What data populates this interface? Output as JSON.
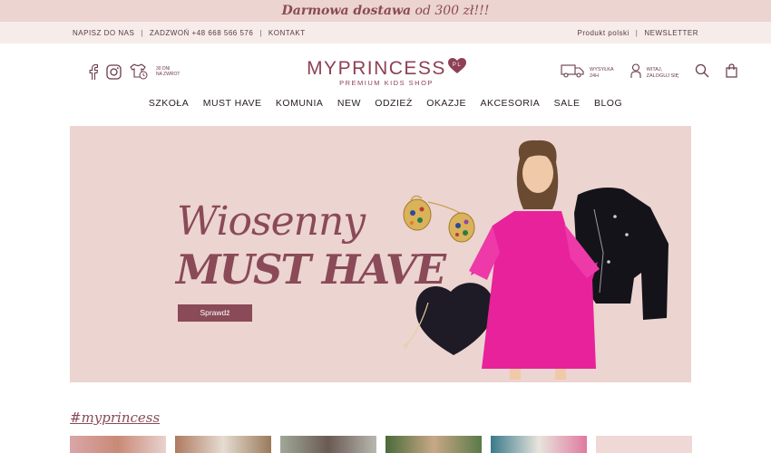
{
  "promo": {
    "bold": "Darmowa dostawa",
    "rest": " od 300 zł!!!"
  },
  "top_links": {
    "left": [
      "NAPISZ DO NAS",
      "ZADZWOŃ +48 668 566 576",
      "KONTAKT"
    ],
    "right": [
      "Produkt polski",
      "NEWSLETTER"
    ]
  },
  "header": {
    "returns_line1": "30 DNI",
    "returns_line2": "NA ZWROT",
    "logo": "MYPRINCESS",
    "logo_badge": "PL",
    "tagline": "PREMIUM KIDS SHOP",
    "shipping_line1": "WYSYŁKA",
    "shipping_line2": "24H",
    "account_line1": "WITAJ,",
    "account_line2": "ZALOGUJ SIĘ"
  },
  "nav": [
    "SZKOŁA",
    "MUST HAVE",
    "KOMUNIA",
    "NEW",
    "ODZIEŻ",
    "OKAZJE",
    "AKCESORIA",
    "SALE",
    "BLOG"
  ],
  "hero": {
    "line1": "Wiosenny",
    "line2": "MUST HAVE",
    "cta": "Sprawdź"
  },
  "hashtag": "#myprincess",
  "colors": {
    "brand": "#8a4a58",
    "hero_bg": "#ecd4d1",
    "dress": "#e8229a"
  }
}
